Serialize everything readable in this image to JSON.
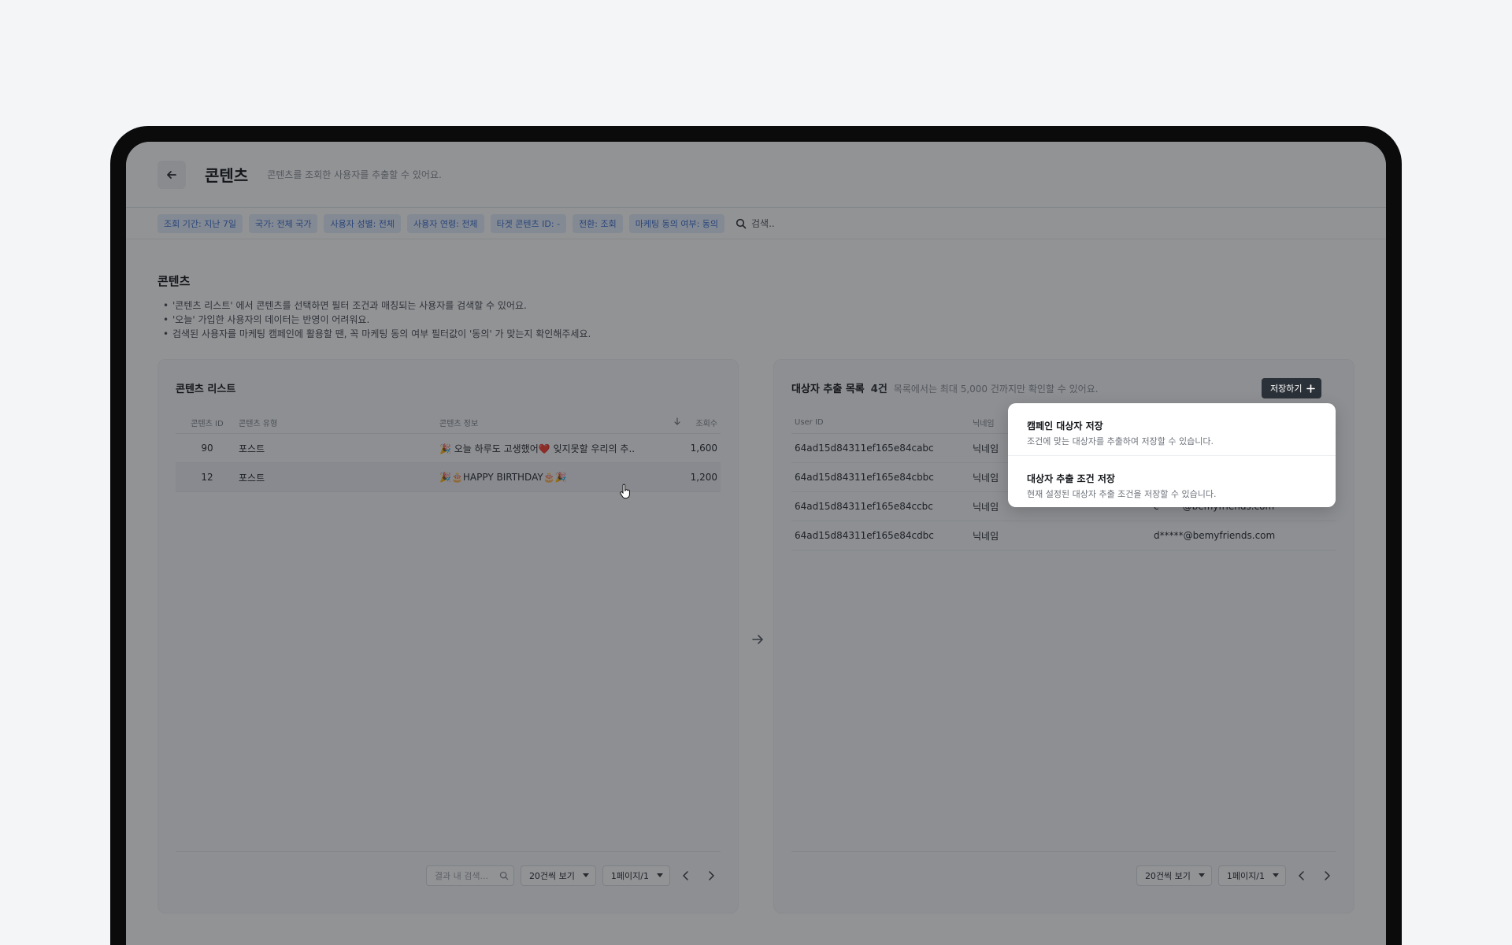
{
  "header": {
    "title": "콘텐츠",
    "description": "콘텐츠를 조회한 사용자를 추출할 수 있어요."
  },
  "filters": [
    "조회 기간: 지난 7일",
    "국가: 전체 국가",
    "사용자 성별: 전체",
    "사용자 연령: 전체",
    "타겟 콘텐츠 ID: -",
    "전환: 조회",
    "마케팅 동의 여부: 동의"
  ],
  "filter_search": {
    "label": "검색.."
  },
  "guide": {
    "title": "콘텐츠",
    "items": [
      "'콘텐츠 리스트' 에서 콘텐츠를 선택하면 필터 조건과 매칭되는 사용자를 검색할 수 있어요.",
      "'오늘' 가입한 사용자의 데이터는 반영이 어려워요.",
      "검색된 사용자를 마케팅 캠페인에 활용할 땐, 꼭 마케팅 동의 여부 필터값이 '동의' 가 맞는지 확인해주세요."
    ]
  },
  "content_list": {
    "title": "콘텐츠 리스트",
    "columns": {
      "id": "콘텐츠 ID",
      "type": "콘텐츠 유형",
      "info": "콘텐츠 정보",
      "views": "조회수"
    },
    "rows": [
      {
        "id": "90",
        "type": "포스트",
        "info": "🎉 오늘 하루도 고생했어❤️ 잊지못할 우리의 추..",
        "views": "1,600"
      },
      {
        "id": "12",
        "type": "포스트",
        "info": "🎉🎂HAPPY BIRTHDAY🎂🎉",
        "views": "1,200"
      }
    ],
    "search_placeholder": "결과 내 검색...",
    "page_size": "20건씩 보기",
    "page": "1페이지/1"
  },
  "extract_list": {
    "title": "대상자 추출 목록",
    "count": "4건",
    "note": "목록에서는 최대 5,000 건까지만 확인할 수 있어요.",
    "save_label": "저장하기",
    "columns": {
      "user_id": "User ID",
      "nickname": "닉네임"
    },
    "rows": [
      {
        "user_id": "64ad15d84311ef165e84cabc",
        "nickname": "닉네임",
        "email": ""
      },
      {
        "user_id": "64ad15d84311ef165e84cbbc",
        "nickname": "닉네임",
        "email": ""
      },
      {
        "user_id": "64ad15d84311ef165e84ccbc",
        "nickname": "닉네임",
        "email": "c*****@bemyfriends.com"
      },
      {
        "user_id": "64ad15d84311ef165e84cdbc",
        "nickname": "닉네임",
        "email": "d*****@bemyfriends.com"
      }
    ],
    "page_size": "20건씩 보기",
    "page": "1페이지/1"
  },
  "save_menu": [
    {
      "title": "캠페인 대상자 저장",
      "desc": "조건에 맞는 대상자를 추출하여 저장할 수 있습니다."
    },
    {
      "title": "대상자 추출 조건 저장",
      "desc": "현재 설정된 대상자 추출 조건을 저장할 수 있습니다."
    }
  ],
  "colors": {
    "chip_bg": "#e6eefb",
    "chip_text": "#3d6fd0",
    "dark_button": "#2b3138"
  }
}
